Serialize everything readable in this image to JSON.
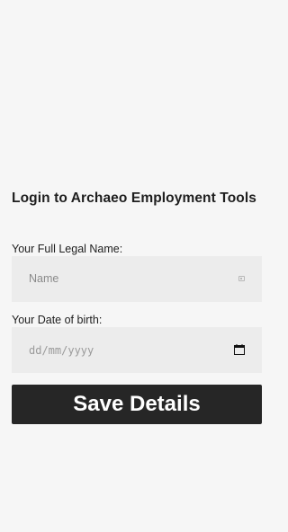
{
  "form": {
    "title": "Login to Archaeo Employment Tools",
    "name_field": {
      "label": "Your Full Legal Name:",
      "placeholder": "Name",
      "icon": "contact-card-icon"
    },
    "dob_field": {
      "label": "Your Date of birth:",
      "placeholder": "dd/mm/yyyy",
      "icon": "calendar-icon"
    },
    "save_label": "Save Details"
  },
  "colors": {
    "background": "#f6f6f6",
    "field_background": "#ececec",
    "button_background": "#262626",
    "button_text": "#ffffff"
  }
}
